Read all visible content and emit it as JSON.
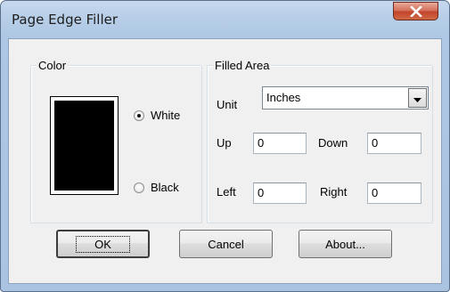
{
  "window": {
    "title": "Page Edge Filler"
  },
  "color_group": {
    "label": "Color",
    "options": [
      {
        "label": "White",
        "selected": true
      },
      {
        "label": "Black",
        "selected": false
      }
    ],
    "swatch_color": "#000000"
  },
  "filled_area": {
    "label": "Filled Area",
    "unit_label": "Unit",
    "unit_value": "Inches",
    "up_label": "Up",
    "up_value": "0",
    "down_label": "Down",
    "down_value": "0",
    "left_label": "Left",
    "left_value": "0",
    "right_label": "Right",
    "right_value": "0"
  },
  "buttons": {
    "ok": "OK",
    "cancel": "Cancel",
    "about": "About..."
  }
}
